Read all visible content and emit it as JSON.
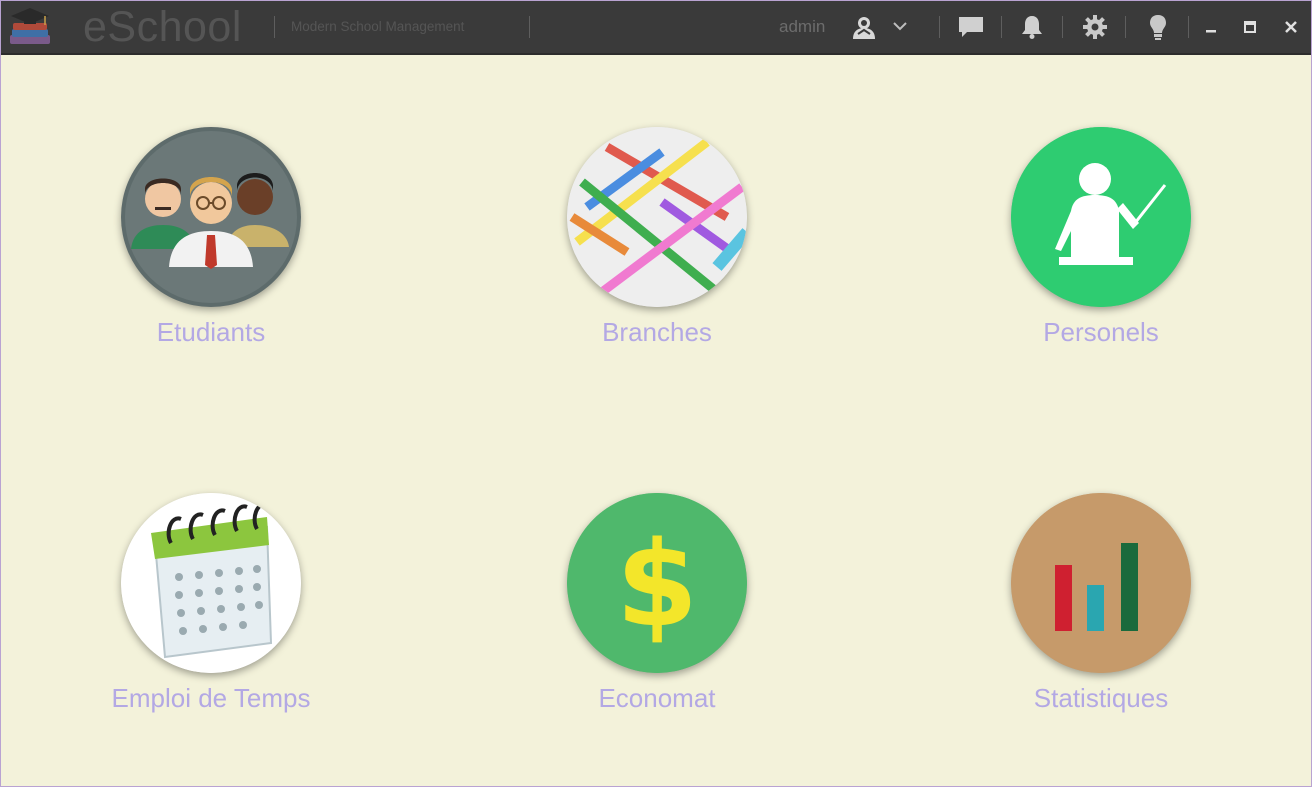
{
  "titlebar": {
    "app_name": "eSchool",
    "tagline": "Modern School Management",
    "username": "admin",
    "icons": [
      "logo-icon",
      "user-avatar-icon",
      "chevron-down-icon",
      "chat-icon",
      "bell-icon",
      "gear-icon",
      "bulb-icon",
      "minimize-icon",
      "maximize-icon",
      "close-icon"
    ]
  },
  "tiles": [
    {
      "label": "Etudiants",
      "icon": "students-icon",
      "color": "#5d6b6b"
    },
    {
      "label": "Branches",
      "icon": "branches-arrows-icon",
      "color": "#f2f2f2"
    },
    {
      "label": "Personels",
      "icon": "teacher-icon",
      "color": "#2ecc71"
    },
    {
      "label": "Emploi de Temps",
      "icon": "calendar-icon",
      "color": "#ffffff"
    },
    {
      "label": "Economat",
      "icon": "dollar-icon",
      "color": "#4fb86c"
    },
    {
      "label": "Statistiques",
      "icon": "bar-chart-icon",
      "color": "#c69a6a"
    }
  ],
  "colors": {
    "titlebar_bg": "#3a3a3a",
    "content_bg": "#f3f2da",
    "label_text": "#b3a8e4",
    "window_border": "#b9a3d2"
  }
}
